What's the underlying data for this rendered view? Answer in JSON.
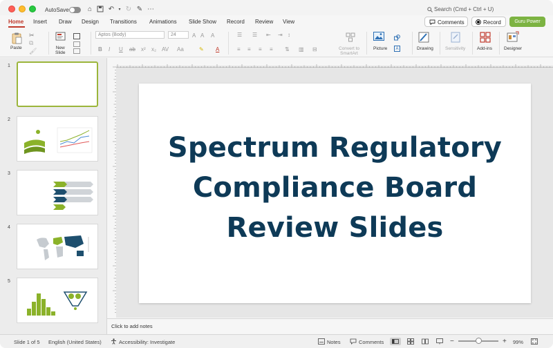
{
  "titlebar": {
    "autosave_label": "AutoSave",
    "search_placeholder": "Search (Cmd + Ctrl + U)"
  },
  "tabs": [
    {
      "label": "Home",
      "active": true
    },
    {
      "label": "Insert"
    },
    {
      "label": "Draw"
    },
    {
      "label": "Design"
    },
    {
      "label": "Transitions"
    },
    {
      "label": "Animations"
    },
    {
      "label": "Slide Show"
    },
    {
      "label": "Record"
    },
    {
      "label": "Review"
    },
    {
      "label": "View"
    }
  ],
  "actions": {
    "comments_label": "Comments",
    "record_label": "Record",
    "guru_label": "Guru Power",
    "guru_color": "#7cb342"
  },
  "ribbon": {
    "paste_label": "Paste",
    "new_slide_label": "New\nSlide",
    "font_name": "Aptos (Body)",
    "font_size": "24",
    "convert_label": "Convert to\nSmartArt",
    "picture_label": "Picture",
    "drawing_label": "Drawing",
    "sensitivity_label": "Sensitivity",
    "addins_label": "Add-ins",
    "designer_label": "Designer"
  },
  "thumbnails": [
    {
      "number": "1",
      "selected": true
    },
    {
      "number": "2"
    },
    {
      "number": "3"
    },
    {
      "number": "4"
    },
    {
      "number": "5"
    }
  ],
  "slide": {
    "title_lines": [
      "Spectrum Regulatory",
      "Compliance Board",
      "Review Slides"
    ],
    "title_color": "#0e3a57"
  },
  "notes_placeholder": "Click to add notes",
  "status": {
    "slide_pos": "Slide 1 of 5",
    "language": "English (United States)",
    "accessibility": "Accessibility: Investigate",
    "notes": "Notes",
    "comments": "Comments",
    "zoom": "99%"
  },
  "accent_color": "#c0392b"
}
